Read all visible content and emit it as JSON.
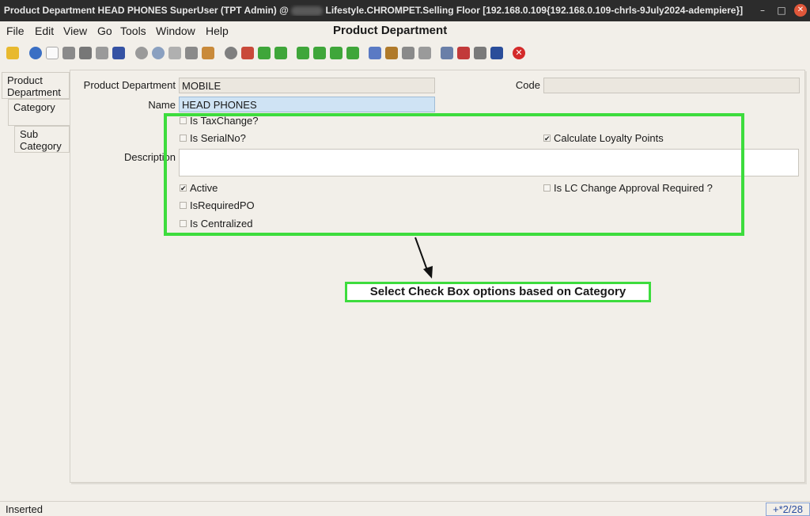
{
  "window": {
    "title_pre": "Product Department  HEAD PHONES  SuperUser (TPT Admin) @ ",
    "title_post": " Lifestyle.CHROMPET.Selling Floor [192.168.0.109{192.168.0.109-chrls-9July2024-adempiere}]",
    "minimize": "–",
    "maximize": "□",
    "close": "✕",
    "heading": "Product Department"
  },
  "menu": {
    "file": "File",
    "edit": "Edit",
    "view": "View",
    "go": "Go",
    "tools": "Tools",
    "window": "Window",
    "help": "Help"
  },
  "toolbar": {
    "icons": [
      "undo-icon",
      "help-icon",
      "new-icon",
      "copy-icon",
      "delete-icon",
      "delete-selection-icon",
      "save-icon",
      "refresh-icon",
      "find-icon",
      "attachment-icon",
      "chat-icon",
      "grid-toggle-icon",
      "history-icon",
      "home-icon",
      "back-icon",
      "forward-icon",
      "first-record-icon",
      "previous-record-icon",
      "next-record-icon",
      "last-record-icon",
      "report-icon",
      "archive-icon",
      "print-icon",
      "print-preview-icon",
      "zoom-across-icon",
      "active-workflows-icon",
      "requests-icon",
      "product-info-icon",
      "end-icon"
    ]
  },
  "tabs": {
    "product_department": "Product\nDepartment",
    "category": "Category",
    "sub_category": "Sub\nCategory"
  },
  "form": {
    "product_department_label": "Product Department",
    "product_department_value": "MOBILE",
    "code_label": "Code",
    "code_value": "",
    "name_label": "Name",
    "name_value": "HEAD PHONES",
    "description_label": "Description",
    "description_value": "",
    "is_taxchange": {
      "label": "Is TaxChange?",
      "checked": false
    },
    "is_serialno": {
      "label": "Is SerialNo?",
      "checked": false
    },
    "calculate_loyalty_points": {
      "label": "Calculate Loyalty Points",
      "checked": true
    },
    "active": {
      "label": "Active",
      "checked": true
    },
    "is_lc_change_approval": {
      "label": "Is LC Change Approval Required ?",
      "checked": false
    },
    "is_required_po": {
      "label": "IsRequiredPO",
      "checked": false
    },
    "is_centralized": {
      "label": "Is Centralized",
      "checked": false
    }
  },
  "annotation": {
    "text": "Select Check Box options based on Category",
    "highlight_color": "#3ddc3d"
  },
  "status": {
    "text": "Inserted",
    "record_nav": "+*2/28"
  },
  "colors": {
    "background": "#f2efe9",
    "title_bar": "#2c2c2c",
    "active_field": "#cfe3f4",
    "annotation_green": "#3ddc3d"
  }
}
